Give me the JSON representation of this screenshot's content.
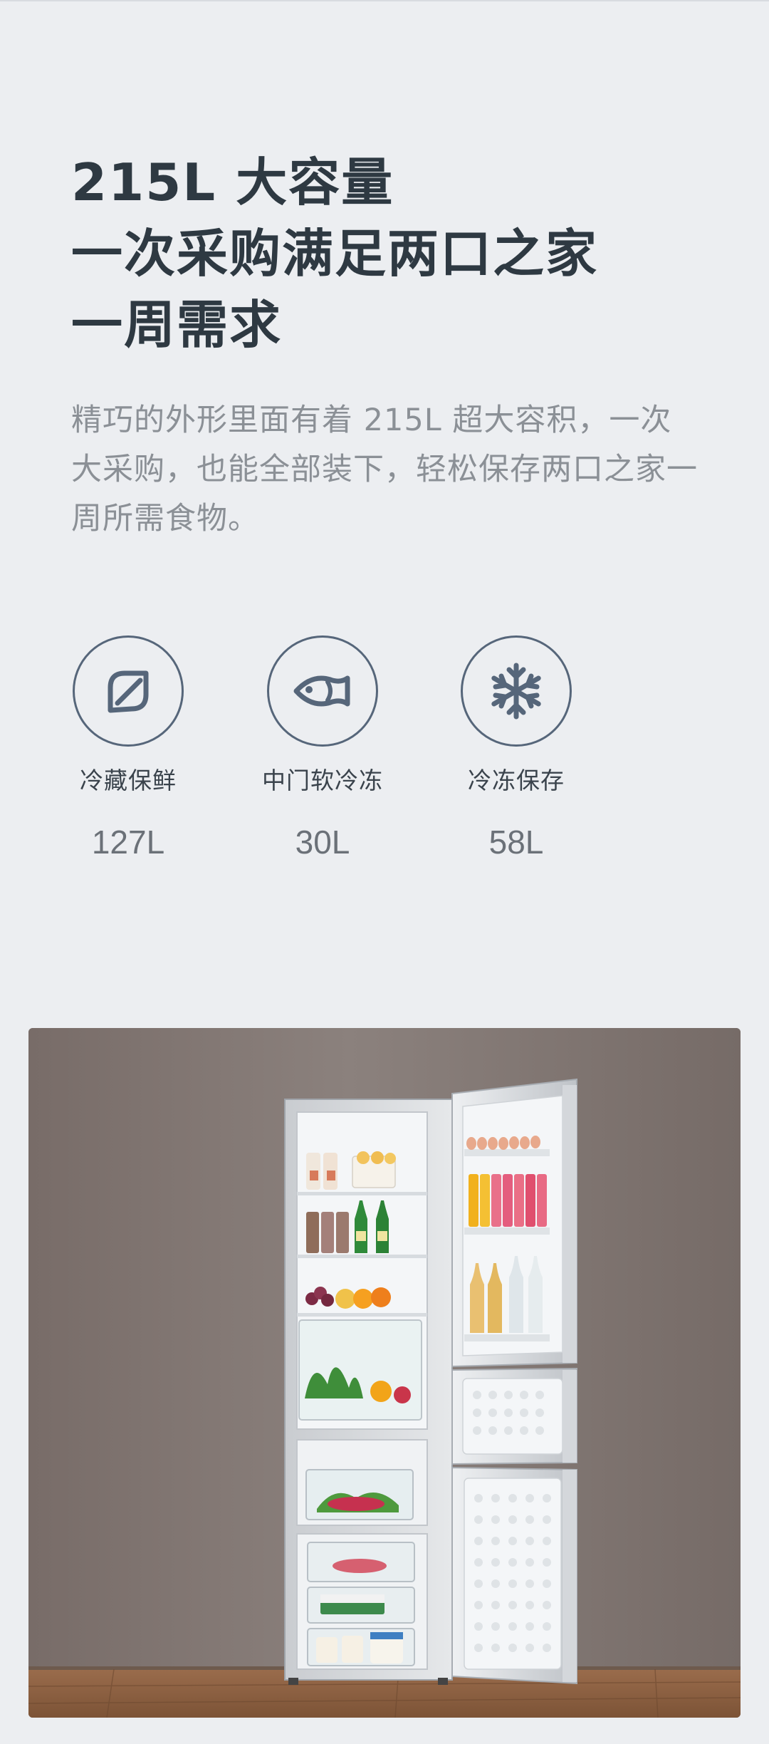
{
  "headline": {
    "lines": [
      "215L 大容量",
      "一次采购满足两口之家",
      "一周需求"
    ]
  },
  "description": "精巧的外形里面有着 215L 超大容积，一次大采购，也能全部装下，轻松保存两口之家一周所需食物。",
  "features": [
    {
      "label": "冷藏保鲜",
      "value": "127L",
      "icon": "leaf-icon"
    },
    {
      "label": "中门软冷冻",
      "value": "30L",
      "icon": "fish-icon"
    },
    {
      "label": "冷冻保存",
      "value": "58L",
      "icon": "snowflake-icon"
    }
  ],
  "colors": {
    "background": "#eceef1",
    "headline": "#2e3942",
    "description": "#8b9096",
    "icon_stroke": "#56667a",
    "photo_wall": "#857a76",
    "photo_floor": "#8a5e40"
  }
}
